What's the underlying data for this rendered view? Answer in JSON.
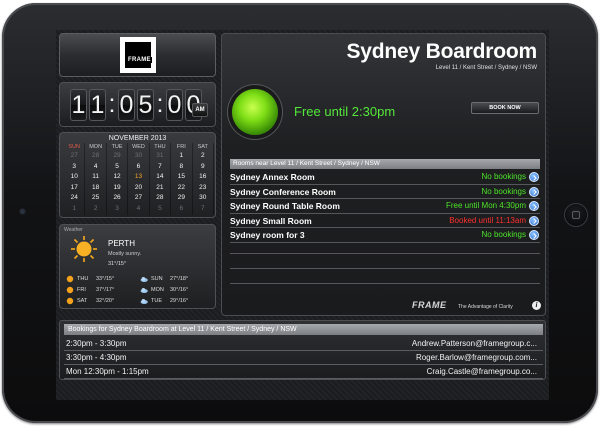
{
  "logo": {
    "brand": "FRAME"
  },
  "clock": {
    "digits": [
      "1",
      "1",
      ":",
      "0",
      "5",
      ":",
      "0",
      "0"
    ],
    "ampm": "AM"
  },
  "calendar": {
    "title": "NOVEMBER 2013",
    "days": [
      "SUN",
      "MON",
      "TUE",
      "WED",
      "THU",
      "FRI",
      "SAT"
    ],
    "weeks": [
      [
        "27",
        "28",
        "29",
        "30",
        "31",
        "1",
        "2"
      ],
      [
        "3",
        "4",
        "5",
        "6",
        "7",
        "8",
        "9"
      ],
      [
        "10",
        "11",
        "12",
        "13",
        "14",
        "15",
        "16"
      ],
      [
        "17",
        "18",
        "19",
        "20",
        "21",
        "22",
        "23"
      ],
      [
        "24",
        "25",
        "26",
        "27",
        "28",
        "29",
        "30"
      ],
      [
        "1",
        "2",
        "3",
        "4",
        "5",
        "6",
        "7"
      ]
    ],
    "today": "13"
  },
  "weather": {
    "label": "Weather",
    "city": "PERTH",
    "condition": "Mostly sunny.",
    "temp": "31°/15°",
    "forecast": [
      {
        "day": "THU",
        "icon": "sun",
        "temp": "33°/15°"
      },
      {
        "day": "SUN",
        "icon": "cloud",
        "temp": "27°/18°"
      },
      {
        "day": "FRI",
        "icon": "sun",
        "temp": "37°/17°"
      },
      {
        "day": "MON",
        "icon": "cloud",
        "temp": "30°/16°"
      },
      {
        "day": "SAT",
        "icon": "sun",
        "temp": "32°/20°"
      },
      {
        "day": "TUE",
        "icon": "cloud",
        "temp": "29°/16°"
      }
    ]
  },
  "room": {
    "title": "Sydney Boardroom",
    "location": "Level 11 / Kent Street / Sydney / NSW",
    "status": "Free until 2:30pm",
    "status_color": "#54e83a",
    "book_label": "BOOK NOW"
  },
  "nearby": {
    "header": "Rooms near Level 11 / Kent Street / Sydney / NSW",
    "rooms": [
      {
        "name": "Sydney Annex Room",
        "status": "No bookings",
        "state": "green"
      },
      {
        "name": "Sydney Conference Room",
        "status": "No bookings",
        "state": "green"
      },
      {
        "name": "Sydney Round Table Room",
        "status": "Free until Mon 4:30pm",
        "state": "green"
      },
      {
        "name": "Sydney Small Room",
        "status": "Booked until 11:13am",
        "state": "red"
      },
      {
        "name": "Sydney room for 3",
        "status": "No bookings",
        "state": "green"
      }
    ]
  },
  "footer": {
    "brand": "FRAME",
    "tagline": "The Advantage of Clarity",
    "info": "i"
  },
  "bookings": {
    "header": "Bookings for Sydney Boardroom at Level 11 / Kent Street / Sydney / NSW",
    "rows": [
      {
        "time": "2:30pm - 3:30pm",
        "who": "Andrew.Patterson@framegroup.c..."
      },
      {
        "time": "3:30pm - 4:30pm",
        "who": "Roger.Barlow@framegroup.com..."
      },
      {
        "time": "Mon 12:30pm - 1:15pm",
        "who": "Craig.Castle@framegroup.co..."
      }
    ]
  }
}
